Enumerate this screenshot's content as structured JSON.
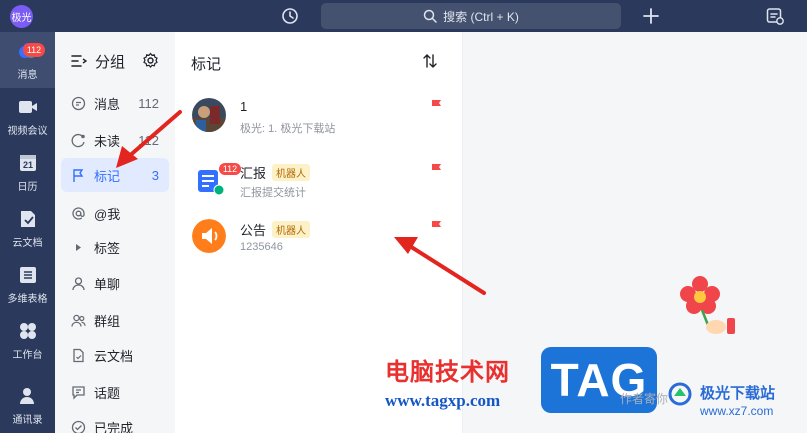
{
  "titlebar": {
    "app_avatar": "极光",
    "search_placeholder": "搜索 (Ctrl + K)",
    "icons": [
      "history-icon",
      "search-icon",
      "plus-icon",
      "todo-icon"
    ]
  },
  "rail": {
    "items": [
      {
        "label": "消息",
        "icon": "message-icon",
        "badge": "112",
        "active": true
      },
      {
        "label": "视频会议",
        "icon": "video-icon"
      },
      {
        "label": "日历",
        "icon": "calendar-icon",
        "glyph": "21"
      },
      {
        "label": "云文档",
        "icon": "cloud-doc-icon"
      },
      {
        "label": "多维表格",
        "icon": "table-icon"
      },
      {
        "label": "工作台",
        "icon": "workbench-icon"
      },
      {
        "label": "通讯录",
        "icon": "contacts-icon"
      }
    ]
  },
  "groups": {
    "title": "分组",
    "items": [
      {
        "label": "消息",
        "count": "112",
        "icon": "chat-icon"
      },
      {
        "label": "未读",
        "count": "112",
        "icon": "unread-icon"
      },
      {
        "label": "标记",
        "count": "3",
        "icon": "flag-icon",
        "active": true
      },
      {
        "label": "@我",
        "count": "",
        "icon": "at-icon"
      },
      {
        "label": "标签",
        "count": "",
        "icon": "caret-right-icon"
      },
      {
        "label": "单聊",
        "count": "",
        "icon": "person-icon"
      },
      {
        "label": "群组",
        "count": "",
        "icon": "group-icon"
      },
      {
        "label": "云文档",
        "count": "",
        "icon": "doc-icon"
      },
      {
        "label": "话题",
        "count": "",
        "icon": "topic-icon"
      },
      {
        "label": "已完成",
        "count": "",
        "icon": "done-icon"
      }
    ]
  },
  "list": {
    "title": "标记",
    "conversations": [
      {
        "name": "1",
        "preview": "极光: 1. 极光下载站",
        "bot": "",
        "avatar_color": "#3a4a5e"
      },
      {
        "name": "汇报",
        "preview": "汇报提交统计",
        "bot": "机器人",
        "badge": "112",
        "avatar_color": "#3370ff"
      },
      {
        "name": "公告",
        "preview": "1235646",
        "bot": "机器人",
        "avatar_color": "#ff7d1a"
      }
    ]
  },
  "colors": {
    "rail_bg": "#2b3a5c",
    "accent": "#3370ff",
    "flag": "#f54a45",
    "badge": "#f54a45"
  },
  "watermark": {
    "cn": "电脑技术网",
    "url": "www.tagxp.com",
    "tag": "TAG",
    "corner": "极光下载站",
    "corner_url": "www.xz7.com",
    "faint": "作者寄你"
  }
}
